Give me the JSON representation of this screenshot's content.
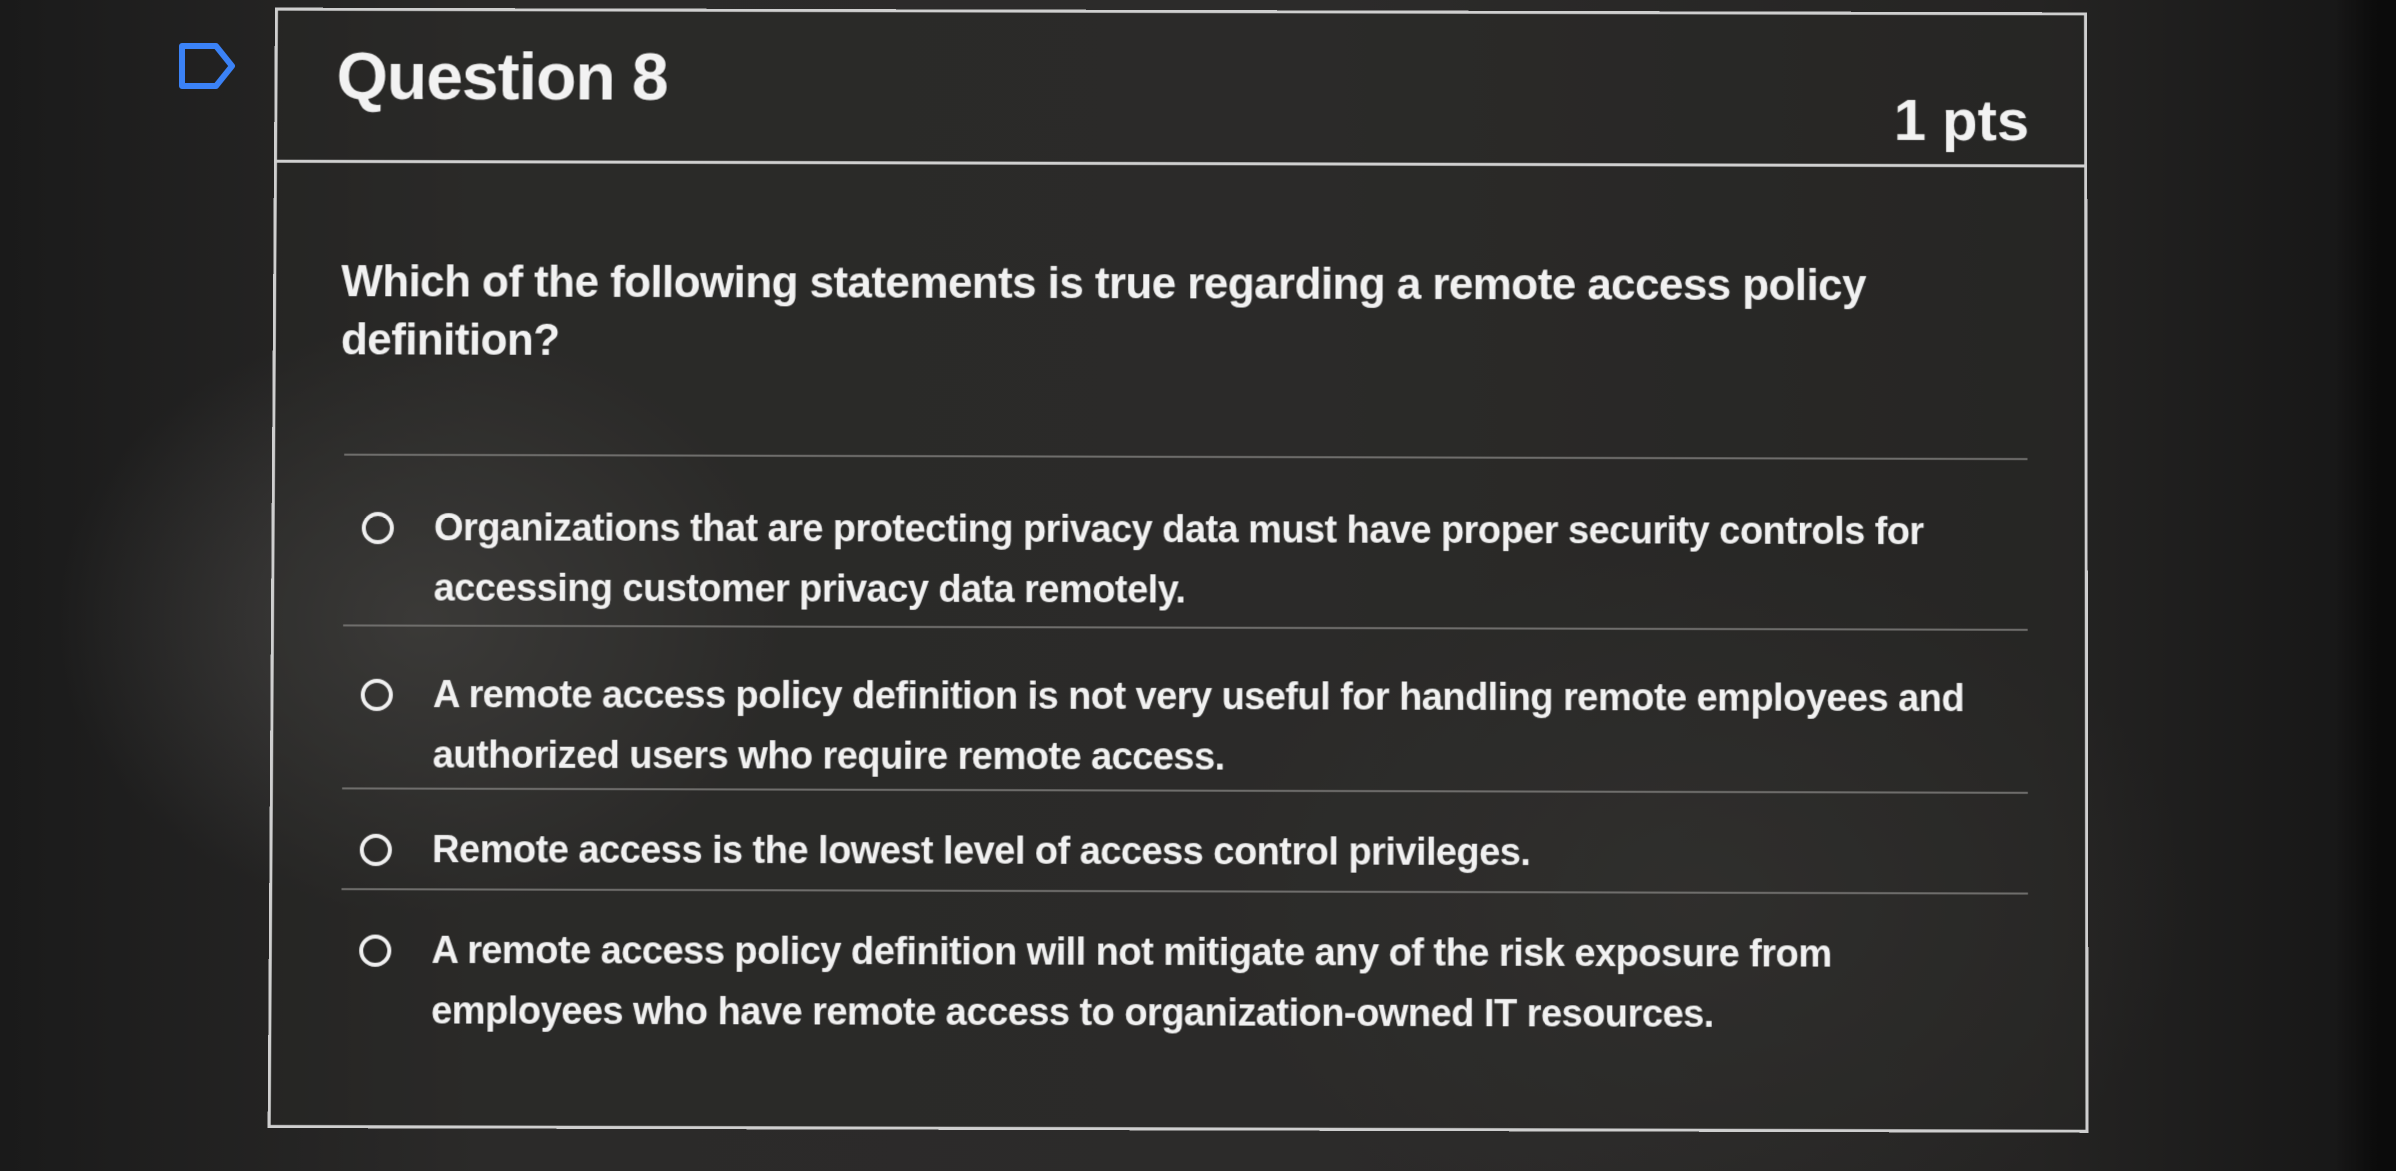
{
  "question": {
    "title": "Question 8",
    "points": "1 pts",
    "prompt": "Which of the following statements is true regarding a remote access policy definition?",
    "flagged": false
  },
  "answers": [
    {
      "label": "Organizations that are protecting privacy data must have proper security controls for accessing customer privacy data remotely.",
      "selected": false
    },
    {
      "label": "A remote access policy definition is not very useful for handling remote employees and authorized users who require remote access.",
      "selected": false
    },
    {
      "label": "Remote access is the lowest level of access control privileges.",
      "selected": false
    },
    {
      "label": "A remote access policy definition will not mitigate any of the risk exposure from employees who have remote access to organization-owned IT resources.",
      "selected": false
    }
  ],
  "icons": {
    "flag": "flag-icon",
    "radio": "radio-button-icon"
  },
  "colors": {
    "text": "#f1f1f1",
    "border": "#cfcfcf",
    "flag_outline": "#3b82f6"
  }
}
